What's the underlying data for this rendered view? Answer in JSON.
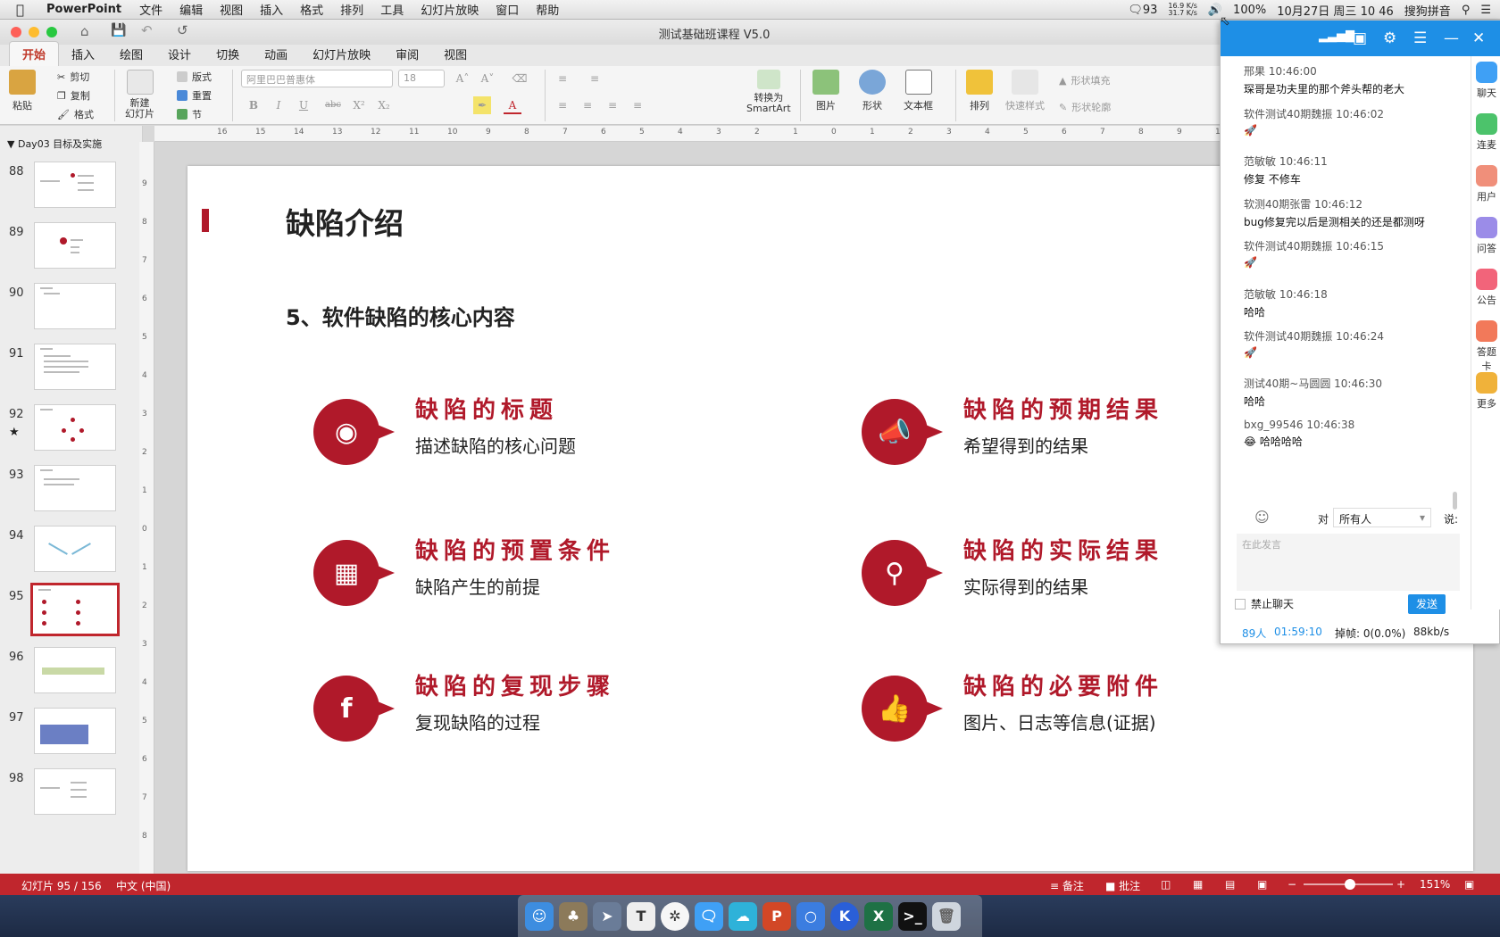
{
  "menubar": {
    "app": "PowerPoint",
    "items": [
      "文件",
      "编辑",
      "视图",
      "插入",
      "格式",
      "排列",
      "工具",
      "幻灯片放映",
      "窗口",
      "帮助"
    ],
    "status": {
      "notif_count": "93",
      "net_up": "16.9 K/s",
      "net_down": "31.7 K/s",
      "battery": "100%",
      "clock": "10月27日 周三 10 46",
      "ime": "搜狗拼音"
    }
  },
  "window": {
    "title": "测试基础班课程 V5.0"
  },
  "ribbon": {
    "tabs": [
      "开始",
      "插入",
      "绘图",
      "设计",
      "切换",
      "动画",
      "幻灯片放映",
      "审阅",
      "视图"
    ],
    "paste": "粘贴",
    "cut": "剪切",
    "copy": "复制",
    "format": "格式",
    "new_slide": "新建\n幻灯片",
    "layout": "版式",
    "reset": "重置",
    "section": "节",
    "font_name": "阿里巴巴普惠体",
    "font_size": "18",
    "smartart": "转换为\nSmartArt",
    "picture": "图片",
    "shape": "形状",
    "textbox": "文本框",
    "arrange": "排列",
    "quick_style": "快速样式",
    "shape_fill": "形状填充",
    "shape_outline": "形状轮廓"
  },
  "sidebar": {
    "section": "Day03 目标及实施",
    "slides": [
      {
        "num": "88"
      },
      {
        "num": "89"
      },
      {
        "num": "90"
      },
      {
        "num": "91"
      },
      {
        "num": "92",
        "star": "★"
      },
      {
        "num": "93"
      },
      {
        "num": "94"
      },
      {
        "num": "95"
      },
      {
        "num": "96"
      },
      {
        "num": "97"
      },
      {
        "num": "98"
      }
    ]
  },
  "ruler": {
    "h_ticks": [
      "16",
      "15",
      "14",
      "13",
      "12",
      "11",
      "10",
      "9",
      "8",
      "7",
      "6",
      "5",
      "4",
      "3",
      "2",
      "1",
      "0",
      "1",
      "2",
      "3",
      "4",
      "5",
      "6",
      "7",
      "8",
      "9",
      "10"
    ],
    "v_ticks": [
      "9",
      "8",
      "7",
      "6",
      "5",
      "4",
      "3",
      "2",
      "1",
      "0",
      "1",
      "2",
      "3",
      "4",
      "5",
      "6",
      "7",
      "8"
    ]
  },
  "slide": {
    "title": "缺陷介绍",
    "subtitle": "5、软件缺陷的核心内容",
    "items": [
      {
        "title": "缺陷的标题",
        "desc": "描述缺陷的核心问题",
        "icon": "camera"
      },
      {
        "title": "缺陷的预期结果",
        "desc": "希望得到的结果",
        "icon": "megaphone"
      },
      {
        "title": "缺陷的预置条件",
        "desc": "缺陷产生的前提",
        "icon": "film"
      },
      {
        "title": "缺陷的实际结果",
        "desc": "实际得到的结果",
        "icon": "magnifier"
      },
      {
        "title": "缺陷的复现步骤",
        "desc": "复现缺陷的过程",
        "icon": "facebook"
      },
      {
        "title": "缺陷的必要附件",
        "desc": "图片、日志等信息(证据)",
        "icon": "thumbs-up"
      }
    ],
    "accent": "#b0192a"
  },
  "statusbar": {
    "slide_info": "幻灯片 95 / 156",
    "lang": "中文 (中国)",
    "notes": "备注",
    "comments": "批注",
    "zoom": "151%"
  },
  "chat": {
    "messages": [
      {
        "name": "邢果",
        "time": "10:46:00",
        "body": "琛哥是功夫里的那个斧头帮的老大"
      },
      {
        "name": "软件测试40期魏振",
        "time": "10:46:02",
        "body": "🚀"
      },
      {
        "name": "范敏敏",
        "time": "10:46:11",
        "body": "修复 不修车"
      },
      {
        "name": "软测40期张雷",
        "time": "10:46:12",
        "body": "bug修复完以后是测相关的还是都测呀"
      },
      {
        "name": "软件测试40期魏振",
        "time": "10:46:15",
        "body": "🚀"
      },
      {
        "name": "范敏敏",
        "time": "10:46:18",
        "body": "哈哈"
      },
      {
        "name": "软件测试40期魏振",
        "time": "10:46:24",
        "body": "🚀"
      },
      {
        "name": "测试40期~马圆圆",
        "time": "10:46:30",
        "body": "哈哈"
      },
      {
        "name": "bxg_99546",
        "time": "10:46:38",
        "body": "😂 哈哈哈哈"
      }
    ],
    "to_label": "对",
    "to_value": "所有人",
    "say_label": "说:",
    "input_placeholder": "在此发言",
    "ban_chat": "禁止聊天",
    "send": "发送",
    "footer": {
      "users": "89人",
      "duration": "01:59:10",
      "drops": "掉帧: 0(0.0%)",
      "bandwidth": "88kb/s"
    },
    "side": [
      "聊天",
      "连麦",
      "用户",
      "问答",
      "公告",
      "答题卡",
      "更多"
    ]
  }
}
